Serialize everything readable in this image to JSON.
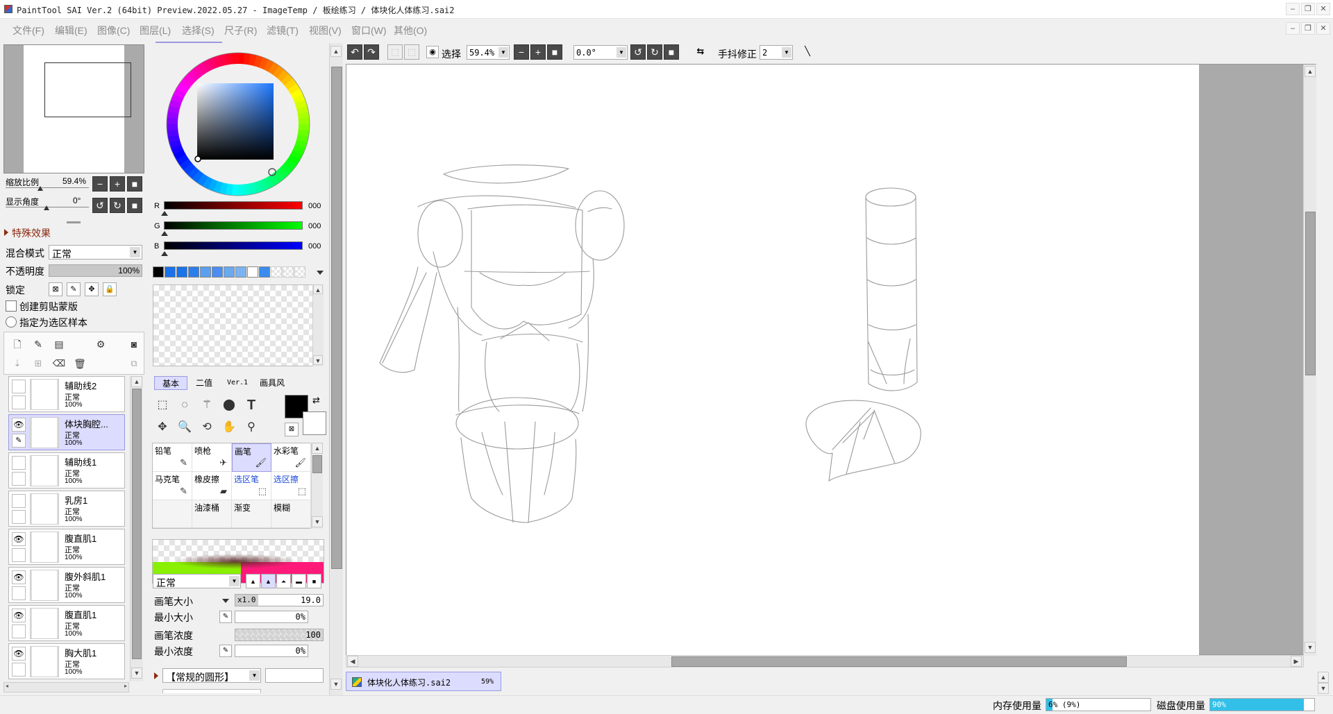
{
  "window": {
    "title": "PaintTool SAI Ver.2 (64bit) Preview.2022.05.27 - ImageTemp / 板绘练习 / 体块化人体练习.sai2",
    "btn_min": "–",
    "btn_restore": "❐",
    "btn_close": "✕"
  },
  "menu": [
    "文件(F)",
    "编辑(E)",
    "图像(C)",
    "图层(L)",
    "选择(S)",
    "尺子(R)",
    "滤镜(T)",
    "视图(V)",
    "窗口(W)",
    "其他(O)"
  ],
  "navigator": {
    "zoom_label": "缩放比例",
    "zoom_value": "59.4%",
    "angle_label": "显示角度",
    "angle_value": "0°"
  },
  "layer_props": {
    "effects_label": "特殊效果",
    "blend_label": "混合模式",
    "blend_value": "正常",
    "opacity_label": "不透明度",
    "opacity_value": "100%",
    "opacity_fraction": 1.0,
    "lock_label": "锁定",
    "clip_label": "创建剪贴蒙版",
    "sample_label": "指定为选区样本"
  },
  "layers": [
    {
      "name": "辅助线2",
      "mode": "正常",
      "opacity": "100%",
      "visible": false,
      "selected": false
    },
    {
      "name": "体块胸腔...",
      "mode": "正常",
      "opacity": "100%",
      "visible": true,
      "selected": true
    },
    {
      "name": "辅助线1",
      "mode": "正常",
      "opacity": "100%",
      "visible": false,
      "selected": false
    },
    {
      "name": "乳房1",
      "mode": "正常",
      "opacity": "100%",
      "visible": false,
      "selected": false
    },
    {
      "name": "腹直肌1",
      "mode": "正常",
      "opacity": "100%",
      "visible": true,
      "selected": false
    },
    {
      "name": "腹外斜肌1",
      "mode": "正常",
      "opacity": "100%",
      "visible": true,
      "selected": false
    },
    {
      "name": "腹直肌1",
      "mode": "正常",
      "opacity": "100%",
      "visible": true,
      "selected": false
    },
    {
      "name": "胸大肌1",
      "mode": "正常",
      "opacity": "100%",
      "visible": true,
      "selected": false
    }
  ],
  "color": {
    "r_label": "R",
    "g_label": "G",
    "b_label": "B",
    "r_value": "000",
    "g_value": "000",
    "b_value": "000",
    "fg": "#000000",
    "bg": "#ffffff",
    "swatches": [
      "#000000",
      "#1a73e8",
      "#1a73e8",
      "#2a7fe8",
      "#5a9ff0",
      "#4a8fef",
      "#6aa8f0",
      "#7bb3f2",
      "#ffffff",
      "#3b8cec"
    ]
  },
  "tool_tabs": [
    "基本",
    "二值",
    "Ver.1",
    "画具风"
  ],
  "brushes": [
    {
      "name": "铅笔",
      "icon": "✎",
      "selected": false,
      "blue": false
    },
    {
      "name": "喷枪",
      "icon": "✈",
      "selected": false,
      "blue": false
    },
    {
      "name": "画笔",
      "icon": "🖌",
      "selected": true,
      "blue": false
    },
    {
      "name": "水彩笔",
      "icon": "🖌",
      "selected": false,
      "blue": false
    },
    {
      "name": "马克笔",
      "icon": "✎",
      "selected": false,
      "blue": false
    },
    {
      "name": "橡皮擦",
      "icon": "▰",
      "selected": false,
      "blue": false
    },
    {
      "name": "选区笔",
      "icon": "⬚",
      "selected": false,
      "blue": true
    },
    {
      "name": "选区擦",
      "icon": "⬚",
      "selected": false,
      "blue": true
    },
    {
      "name": "",
      "icon": "",
      "selected": false,
      "blue": false
    },
    {
      "name": "油漆桶",
      "icon": "",
      "selected": false,
      "blue": false
    },
    {
      "name": "渐变",
      "icon": "",
      "selected": false,
      "blue": false
    },
    {
      "name": "模糊",
      "icon": "",
      "selected": false,
      "blue": false
    }
  ],
  "brush_settings": {
    "blend_value": "正常",
    "size_label": "画笔大小",
    "size_mult": "x1.0",
    "size_value": "19.0",
    "min_size_label": "最小大小",
    "min_size_value": "0%",
    "density_label": "画笔浓度",
    "density_value": "100",
    "min_density_label": "最小浓度",
    "min_density_value": "0%",
    "shape_label": "【常规的圆形】"
  },
  "toolbar": {
    "select_label": "选择",
    "zoom_value": "59.4%",
    "angle_value": "0.0°",
    "stabilizer_label": "手抖修正",
    "stabilizer_value": "2"
  },
  "doc_tab": {
    "name": "体块化人体练习.sai2",
    "zoom": "59%"
  },
  "status": {
    "mem_label": "内存使用量",
    "mem_value": "6% (9%)",
    "mem_fraction": 0.06,
    "disk_label": "磁盘使用量",
    "disk_value": "90%",
    "disk_fraction": 0.9
  }
}
